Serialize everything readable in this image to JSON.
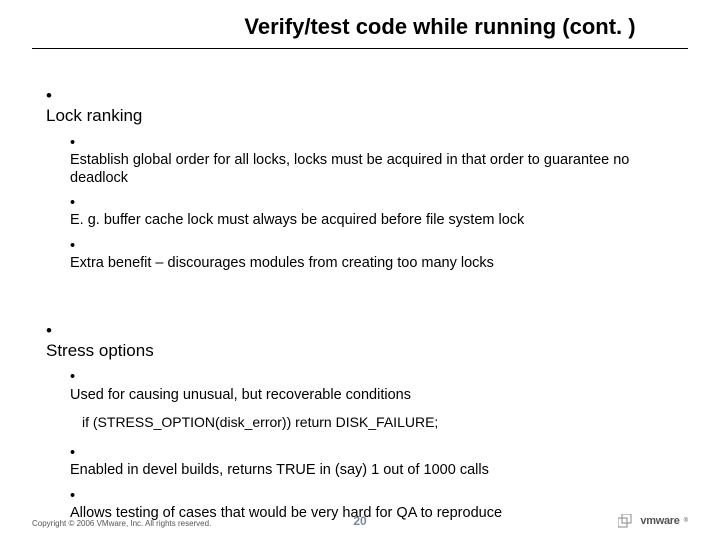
{
  "title": "Verify/test code while running (cont. )",
  "bullets": {
    "lock_ranking": "Lock ranking",
    "lock_sub1": "Establish global order for all locks, locks must be acquired in that order to guarantee no deadlock",
    "lock_sub2": "E. g. buffer cache lock must always be acquired before file system lock",
    "lock_sub3": "Extra benefit – discourages modules from creating too many locks",
    "stress": "Stress options",
    "stress_sub1": "Used for causing unusual, but recoverable conditions",
    "code": "if  (STRESS_OPTION(disk_error))   return DISK_FAILURE;",
    "stress_sub2": "Enabled in devel builds, returns TRUE in (say) 1 out of 1000 calls",
    "stress_sub3": "Allows testing of cases that would be very hard for QA to reproduce"
  },
  "footer": {
    "copyright": "Copyright © 2006 VMware, Inc. All rights reserved.",
    "page": "20",
    "logo_text": "vmware"
  }
}
